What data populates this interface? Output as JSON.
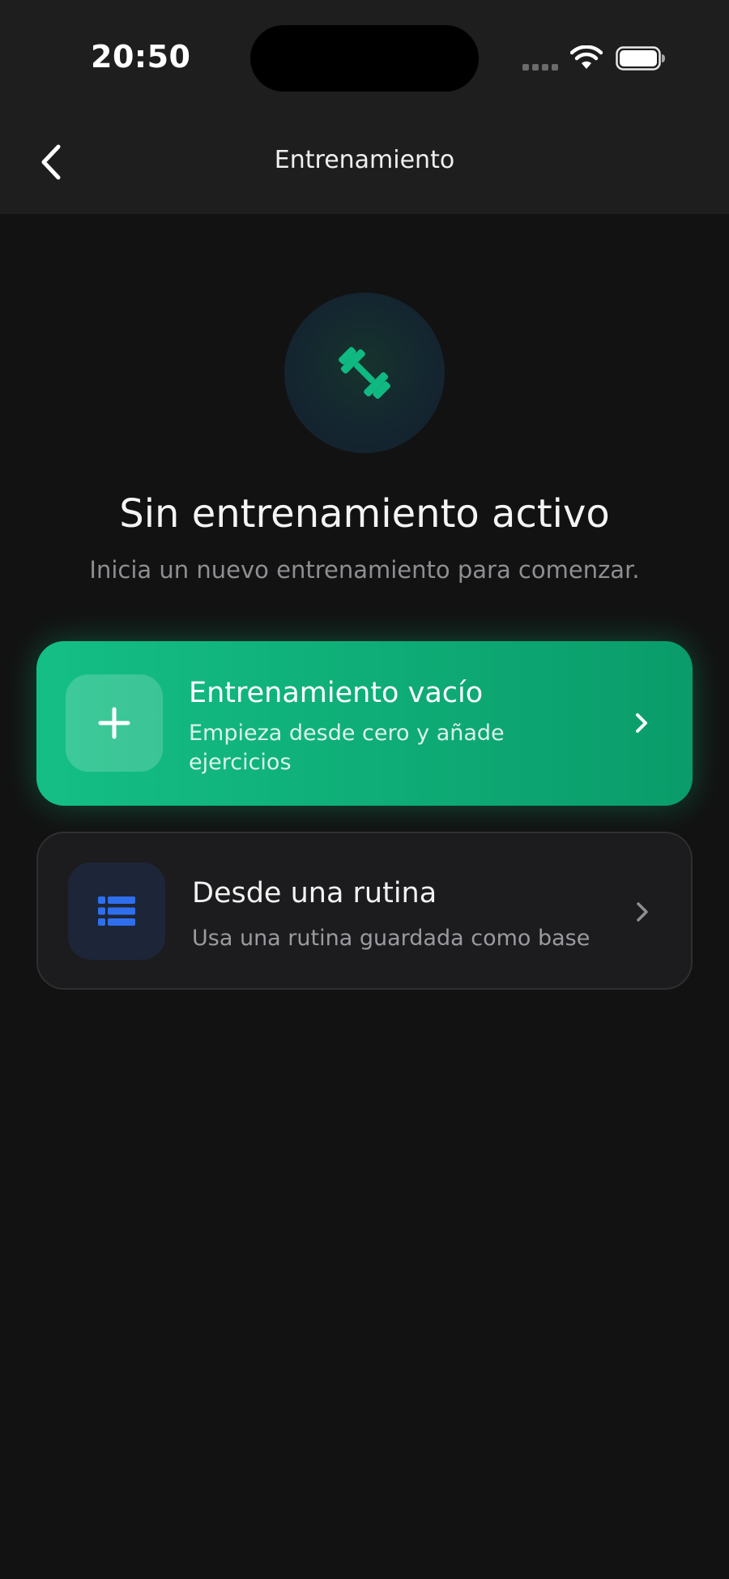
{
  "status_bar": {
    "time": "20:50"
  },
  "nav": {
    "back_icon": "chevron-left-icon",
    "title": "Entrenamiento"
  },
  "empty_state": {
    "icon": "dumbbell-icon",
    "title": "Sin entrenamiento activo",
    "subtitle": "Inicia un nuevo entrenamiento para comenzar."
  },
  "options": [
    {
      "icon": "plus-icon",
      "title": "Entrenamiento vacío",
      "description": "Empieza desde cero y añade ejercicios",
      "chevron_icon": "chevron-right-icon"
    },
    {
      "icon": "list-icon",
      "title": "Desde una rutina",
      "description": "Usa una rutina guardada como base",
      "chevron_icon": "chevron-right-icon"
    }
  ],
  "colors": {
    "background": "#121212",
    "header": "#1e1e1e",
    "accent_green": "#10b981",
    "accent_blue": "#2563eb",
    "card_dark": "#1c1c1e"
  }
}
